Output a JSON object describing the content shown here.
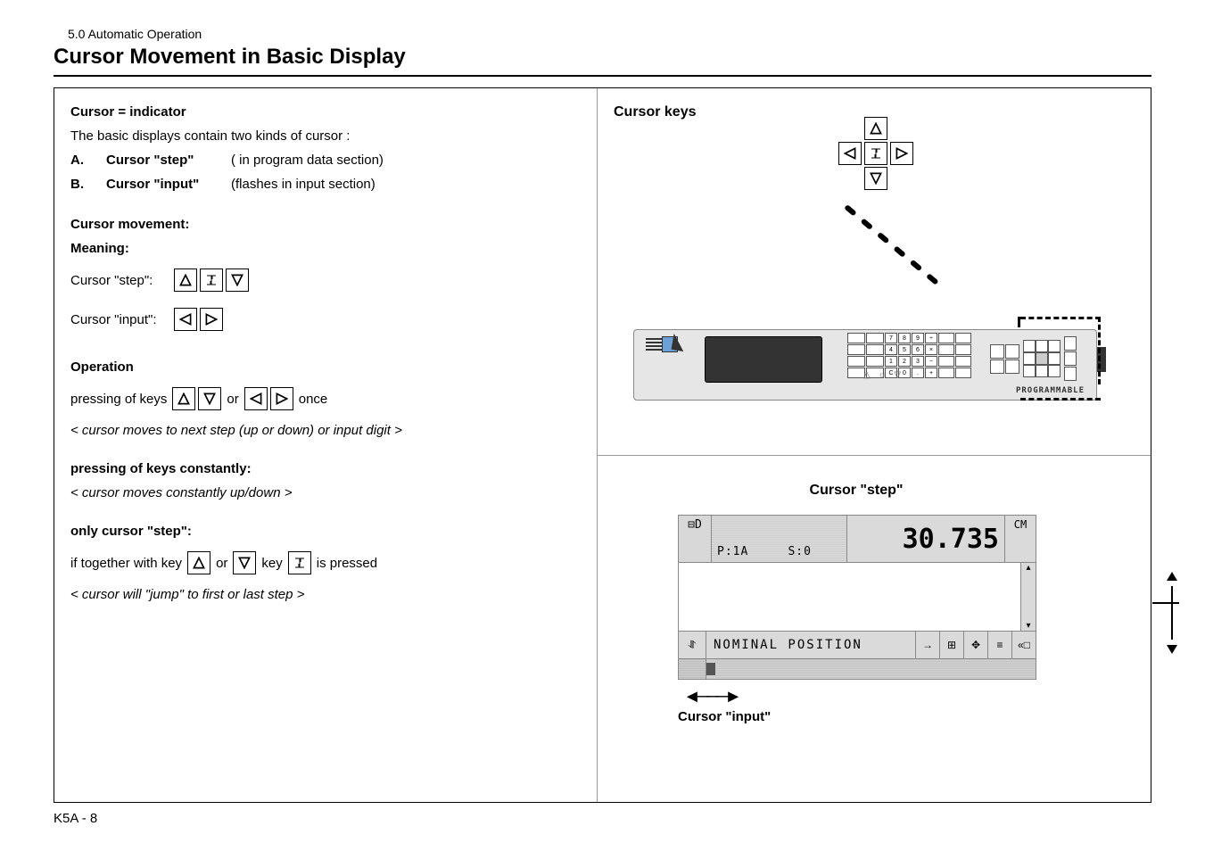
{
  "header": {
    "section": "5.0 Automatic Operation",
    "title": "Cursor Movement in Basic Display"
  },
  "footer": {
    "page": "K5A - 8"
  },
  "left": {
    "cursor_indicator": "Cursor = indicator",
    "intro": "The basic displays contain two kinds of cursor :",
    "itemA": {
      "letter": "A.",
      "name": "Cursor \"step\"",
      "desc": "( in program data section)"
    },
    "itemB": {
      "letter": "B.",
      "name": "Cursor \"input\"",
      "desc": "(flashes in input section)"
    },
    "cursor_movement": "Cursor movement:",
    "meaning": "Meaning:",
    "step_label": "Cursor \"step\":",
    "input_label": "Cursor \"input\":",
    "operation": "Operation",
    "pressing_keys": "pressing of keys",
    "or": "or",
    "once": "once",
    "result1": "< cursor moves to next step (up or down) or input digit >",
    "constantly": "pressing of keys constantly:",
    "result2": "< cursor moves constantly up/down >",
    "only_step": "only cursor \"step\":",
    "together1": "if together with key",
    "together2": "key",
    "is_pressed": "is pressed",
    "result3": "< cursor will \"jump\" to first or last step >"
  },
  "right_top": {
    "title": "Cursor keys",
    "programmable": "PROGRAMMABLE",
    "brightness": "△ ☼ ▽",
    "keypad_rows": [
      [
        "",
        "",
        "7",
        "8",
        "9",
        "÷",
        "",
        ""
      ],
      [
        "",
        "",
        "4",
        "5",
        "6",
        "×",
        "",
        ""
      ],
      [
        "",
        "",
        "1",
        "2",
        "3",
        "−",
        "",
        ""
      ],
      [
        "",
        "",
        "C",
        "0",
        ".",
        "+",
        "",
        ""
      ]
    ]
  },
  "right_bottom": {
    "title": "Cursor \"step\"",
    "h_left": "⊟D",
    "p_line": "P:1A",
    "s_line": "S:0",
    "value": "30.735",
    "unit": "CM",
    "footer_icon": "⥯",
    "footer_text": "NOMINAL POSITION",
    "footer_btns": [
      "→",
      "⊞",
      "✥",
      "≡",
      "«□"
    ],
    "input_label": "Cursor \"input\""
  }
}
